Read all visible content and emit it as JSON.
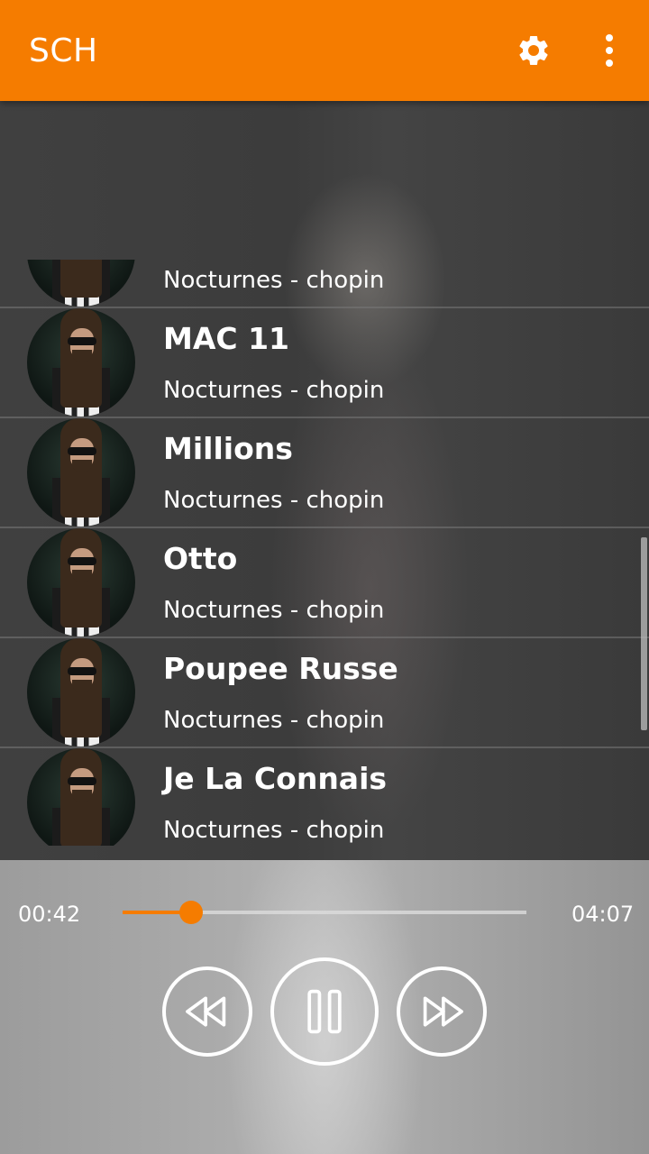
{
  "app_bar": {
    "title": "SCH",
    "background_color": "#f57c00",
    "actions": [
      {
        "icon": "gear-icon",
        "label": "Settings"
      },
      {
        "icon": "overflow-menu-icon",
        "label": "More options"
      }
    ]
  },
  "songs": [
    {
      "title": "",
      "artist": "Nocturnes - chopin"
    },
    {
      "title": "MAC 11",
      "artist": "Nocturnes - chopin"
    },
    {
      "title": "Millions",
      "artist": "Nocturnes - chopin"
    },
    {
      "title": "Otto",
      "artist": "Nocturnes - chopin"
    },
    {
      "title": "Poupee Russe",
      "artist": "Nocturnes - chopin"
    },
    {
      "title": "Je La Connais",
      "artist": "Nocturnes - chopin"
    }
  ],
  "player": {
    "current_time": "00:42",
    "total_time": "04:07",
    "progress": 0.17,
    "accent_color": "#f57c00",
    "controls": [
      {
        "icon": "rewind-icon"
      },
      {
        "icon": "pause-icon"
      },
      {
        "icon": "fast-forward-icon"
      }
    ]
  }
}
